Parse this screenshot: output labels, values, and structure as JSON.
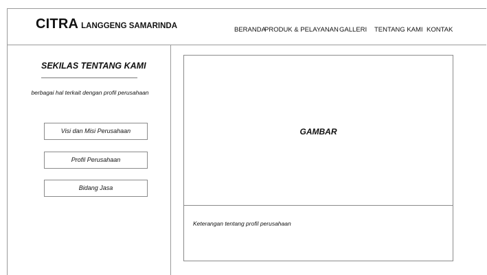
{
  "header": {
    "logo_main": "CITRA",
    "logo_sub": "LANGGENG SAMARINDA"
  },
  "nav": {
    "items": [
      {
        "label": "BERANDA"
      },
      {
        "label": "PRODUK & PELAYANAN"
      },
      {
        "label": "GALLERI"
      },
      {
        "label": "TENTANG KAMI"
      },
      {
        "label": "KONTAK"
      }
    ]
  },
  "sidebar": {
    "title": "SEKILAS TENTANG KAMI",
    "description": "berbagai hal terkait dengan profil perusahaan",
    "buttons": [
      {
        "label": "Visi dan Misi Perusahaan"
      },
      {
        "label": "Profil Perusahaan"
      },
      {
        "label": "Bidang Jasa"
      }
    ]
  },
  "main": {
    "image_label": "GAMBAR",
    "caption": "Keterangan tentang profil perusahaan"
  }
}
